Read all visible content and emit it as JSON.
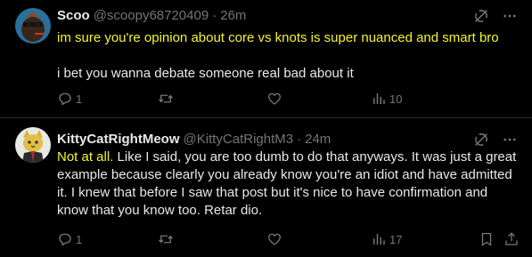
{
  "posts": [
    {
      "author": {
        "name": "Scoo",
        "handle": "@scoopy68720409",
        "time": "26m"
      },
      "separator": "·",
      "highlight": "im sure you're opinion about core vs knots is super nuanced and smart bro",
      "text": "\n\ni bet you wanna debate someone real bad about it",
      "stats": {
        "replies": "1",
        "views": "10"
      },
      "colors": {
        "highlight": "#f5f52e"
      }
    },
    {
      "author": {
        "name": "KittyCatRightMeow",
        "handle": "@KittyCatRightM3",
        "time": "24m"
      },
      "separator": "·",
      "highlight": "Not at all.",
      "text": " Like I said, you are too dumb to do that anyways. It was just a great example because clearly you already know you're an idiot and have admitted it. I knew that before I saw that post but it's nice to have confirmation and know that you know too. Retar dio.",
      "stats": {
        "replies": "1",
        "views": "17"
      },
      "colors": {
        "highlight": "#f5f52e"
      }
    }
  ],
  "icons": [
    "grok-icon",
    "more-icon",
    "reply-icon",
    "repost-icon",
    "like-icon",
    "views-icon",
    "bookmark-icon",
    "share-icon"
  ],
  "theme": {
    "background": "#000000",
    "text": "#e7e9ea",
    "muted": "#71767b",
    "border": "#2f3336"
  }
}
